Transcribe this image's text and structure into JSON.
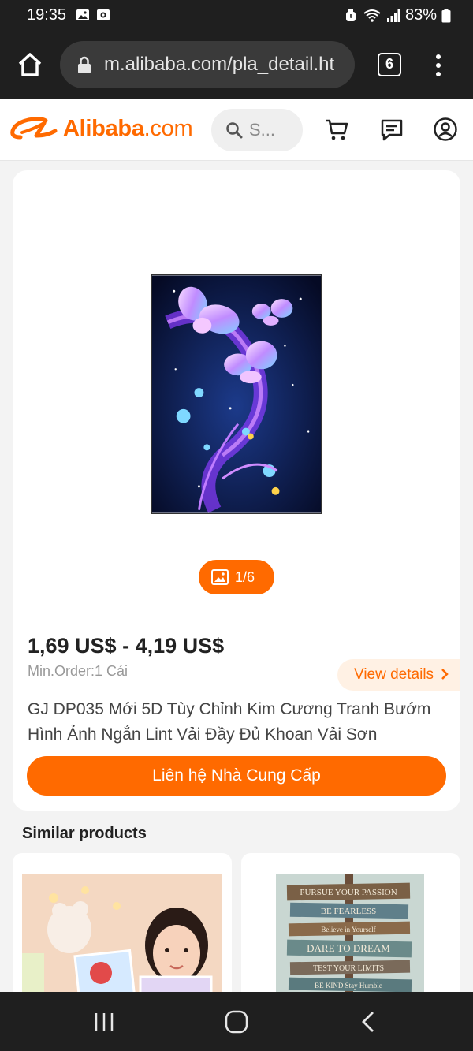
{
  "status_bar": {
    "time": "19:35",
    "battery": "83%"
  },
  "browser": {
    "url": "m.alibaba.com/pla_detail.ht",
    "tab_count": "6"
  },
  "header": {
    "logo_brand": "Alibaba",
    "logo_suffix": ".com",
    "search_placeholder": "S..."
  },
  "product": {
    "image_counter": "1/6",
    "price": "1,69 US$ - 4,19 US$",
    "min_order": "Min.Order:1 Cái",
    "view_details": "View details",
    "title": "GJ DP035 Mới 5D Tùy Chỉnh Kim Cương Tranh Bướm Hình Ảnh Ngắn Lint Vải Đầy Đủ Khoan Vải Sơn",
    "contact_button": "Liên hệ Nhà Cung Cấp"
  },
  "similar": {
    "heading": "Similar products",
    "sign_lines": [
      "PURSUE YOUR PASSION",
      "BE FEARLESS",
      "Believe in Yourself",
      "DARE TO DREAM",
      "TEST YOUR LIMITS",
      "BE KIND  Stay Humble"
    ]
  },
  "colors": {
    "accent": "#ff6a00",
    "dark_bar": "#1f1f1f"
  }
}
